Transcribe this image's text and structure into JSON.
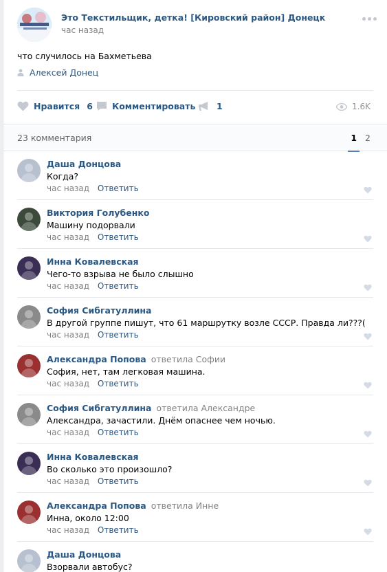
{
  "post": {
    "group_name": "Это Текстильщик, детка! [Кировский район] Донецк",
    "time": "час назад",
    "text": "что случилось на Бахметьева",
    "author": "Алексей Донец",
    "avatar_text": "Это Текстильщик, детка"
  },
  "actions": {
    "like_label": "Нравится",
    "like_count": "6",
    "comment_label": "Комментировать",
    "share_count": "1",
    "views": "1.6K"
  },
  "comments_header": {
    "count_label": "23 комментария",
    "pages": [
      "1",
      "2"
    ]
  },
  "comments": [
    {
      "name": "Даша Донцова",
      "replied": "",
      "to": "",
      "text": "Когда?",
      "time": "час назад",
      "reply_label": "Ответить",
      "avatar_color": "#b7c0cf"
    },
    {
      "name": "Виктория Голубенко",
      "replied": "",
      "to": "",
      "text": "Машину подорвали",
      "time": "час назад",
      "reply_label": "Ответить",
      "avatar_color": "#3b4a3a"
    },
    {
      "name": "Инна Ковалевская",
      "replied": "",
      "to": "",
      "text": "Чего-то взрыва не было слышно",
      "time": "час назад",
      "reply_label": "Ответить",
      "avatar_color": "#3a2e55"
    },
    {
      "name": "София Сибгатуллина",
      "replied": "",
      "to": "",
      "text": "В другой группе пишут, что 61 маршрутку возле СССР. Правда ли???(",
      "time": "час назад",
      "reply_label": "Ответить",
      "avatar_color": "#8a8a8a"
    },
    {
      "name": "Александра Попова",
      "replied": "ответила",
      "to": "Софии",
      "text": "София, нет, там легковая машина.",
      "time": "час назад",
      "reply_label": "Ответить",
      "avatar_color": "#9a3030"
    },
    {
      "name": "София Сибгатуллина",
      "replied": "ответила",
      "to": "Александре",
      "text": "Александра, зачастили. Днём опаснее чем ночью.",
      "time": "час назад",
      "reply_label": "Ответить",
      "avatar_color": "#8a8a8a"
    },
    {
      "name": "Инна Ковалевская",
      "replied": "",
      "to": "",
      "text": "Во сколько это произошло?",
      "time": "час назад",
      "reply_label": "Ответить",
      "avatar_color": "#3a2e55"
    },
    {
      "name": "Александра Попова",
      "replied": "ответила",
      "to": "Инне",
      "text": "Инна, около 12:00",
      "time": "час назад",
      "reply_label": "Ответить",
      "avatar_color": "#9a3030"
    },
    {
      "name": "Даша Донцова",
      "replied": "",
      "to": "",
      "text": "Взорвали автобус?",
      "time": "час назад",
      "reply_label": "Ответить",
      "avatar_color": "#b7c0cf"
    }
  ],
  "colors": {
    "link": "#2a5885",
    "muted": "#828282",
    "accent": "#5181b8",
    "icon": "#c4c9d1"
  },
  "icons": {
    "like": "heart-icon",
    "comment": "speech-bubble-icon",
    "share": "megaphone-icon",
    "views": "eye-icon",
    "author": "person-icon",
    "more": "ellipsis-icon"
  }
}
